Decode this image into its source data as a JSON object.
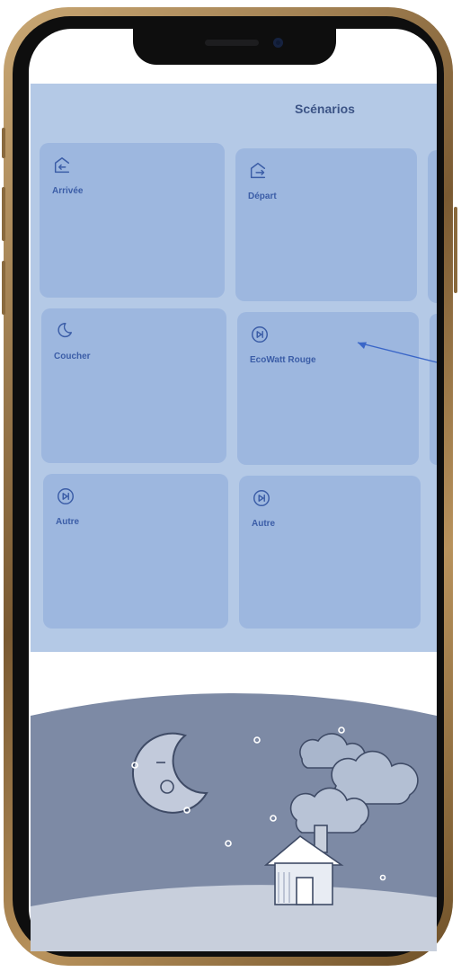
{
  "screen": {
    "title": "Scénarios",
    "tiles": [
      {
        "label": "Arrivée",
        "icon": "home-enter-icon"
      },
      {
        "label": "Départ",
        "icon": "home-exit-icon"
      },
      {
        "label": "Coucher",
        "icon": "moon-icon"
      },
      {
        "label": "EcoWatt Rouge",
        "icon": "play-skip-icon"
      },
      {
        "label": "Autre",
        "icon": "play-skip-icon"
      },
      {
        "label": "Autre",
        "icon": "play-skip-icon"
      }
    ]
  },
  "colors": {
    "app_background": "#b4c9e6",
    "tile": "#9db7df",
    "accent": "#3b5da7",
    "night_sky": "#7d8aa5",
    "ground": "#c8cfdc"
  },
  "illustration": {
    "description_icons": [
      "moon-icon",
      "star-icon",
      "cloud-icon",
      "house-icon",
      "chimney-smoke-icon"
    ]
  }
}
